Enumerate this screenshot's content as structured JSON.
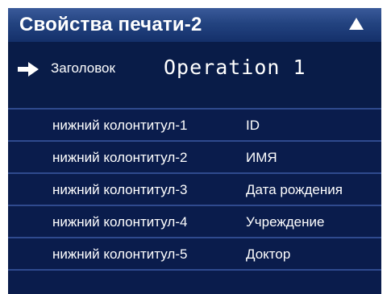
{
  "header": {
    "title": "Свойства печати-2",
    "scroll_icon": "triangle-up-icon"
  },
  "title_field": {
    "pointer_icon": "right-arrow-icon",
    "label": "Заголовок",
    "value": "Operation 1"
  },
  "footers": [
    {
      "label": "нижний колонтитул-1",
      "value": "ID"
    },
    {
      "label": "нижний колонтитул-2",
      "value": "ИМЯ"
    },
    {
      "label": "нижний колонтитул-3",
      "value": "Дата рождения"
    },
    {
      "label": "нижний колонтитул-4",
      "value": "Учреждение"
    },
    {
      "label": "нижний колонтитул-5",
      "value": "Доктор"
    }
  ],
  "colors": {
    "header_bg": "#234380",
    "row_bg": "#0a1c4c",
    "divider": "#2f4a8e",
    "text": "#ffffff"
  }
}
